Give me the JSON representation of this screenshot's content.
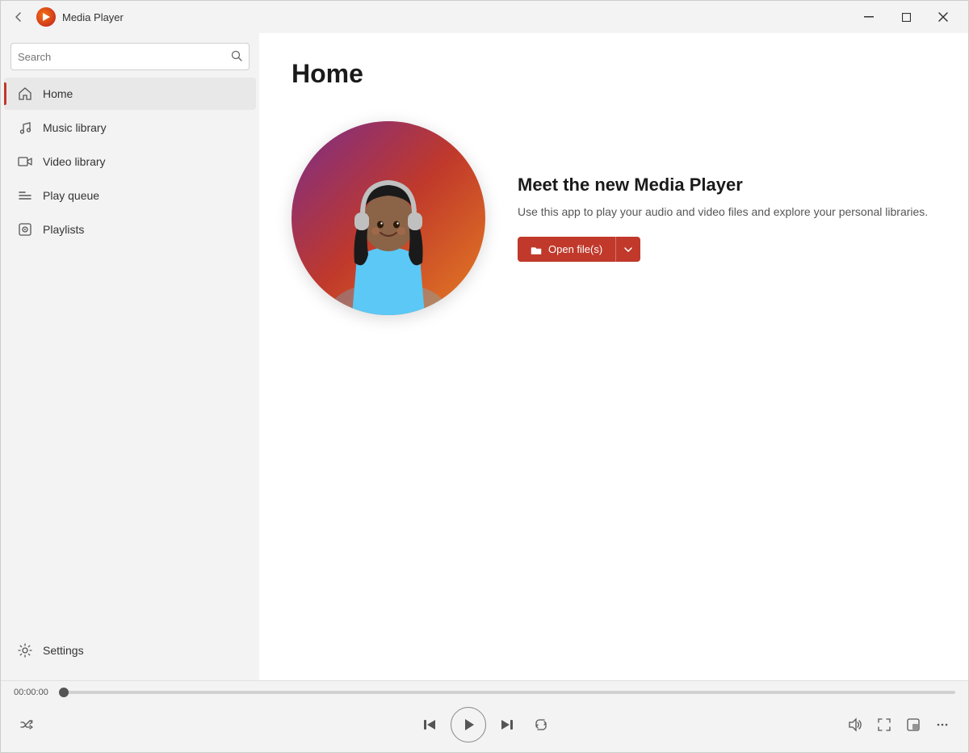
{
  "titleBar": {
    "appTitle": "Media Player",
    "minimizeTitle": "Minimize",
    "maximizeTitle": "Maximize",
    "closeTitle": "Close"
  },
  "sidebar": {
    "searchPlaceholder": "Search",
    "navItems": [
      {
        "id": "home",
        "label": "Home",
        "active": true
      },
      {
        "id": "music-library",
        "label": "Music library",
        "active": false
      },
      {
        "id": "video-library",
        "label": "Video library",
        "active": false
      },
      {
        "id": "play-queue",
        "label": "Play queue",
        "active": false
      },
      {
        "id": "playlists",
        "label": "Playlists",
        "active": false
      }
    ],
    "settingsLabel": "Settings"
  },
  "mainContent": {
    "pageTitle": "Home",
    "hero": {
      "title": "Meet the new Media Player",
      "description": "Use this app to play your audio and video files and explore your personal libraries.",
      "openFilesLabel": "Open file(s)"
    }
  },
  "playerBar": {
    "timeDisplay": "00:00:00",
    "progressPercent": 0,
    "controls": {
      "shuffle": "shuffle",
      "previous": "previous",
      "play": "play",
      "next": "next",
      "repeat": "repeat",
      "volume": "volume",
      "fullscreen": "fullscreen",
      "miniPlayer": "mini-player",
      "more": "more"
    }
  }
}
